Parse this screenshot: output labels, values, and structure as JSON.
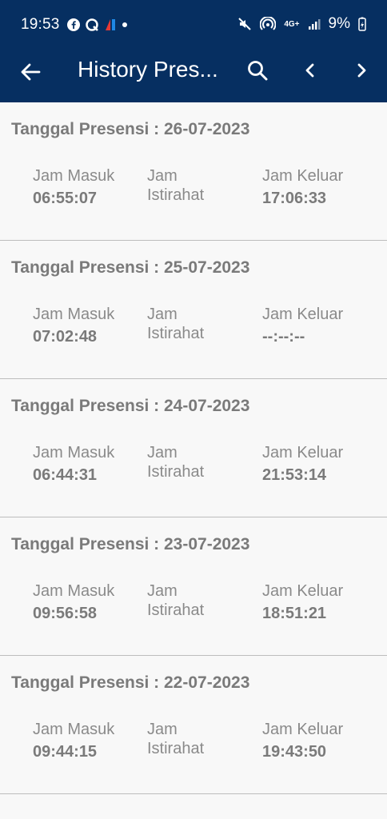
{
  "status_bar": {
    "time": "19:53",
    "battery": "9%",
    "network": "4G+"
  },
  "app_bar": {
    "title": "History Pres..."
  },
  "labels": {
    "date_prefix": "Tanggal Presensi : ",
    "jam_masuk": "Jam Masuk",
    "jam_istirahat": "Jam Istirahat",
    "jam_keluar": "Jam Keluar"
  },
  "records": [
    {
      "date": "26-07-2023",
      "masuk": "06:55:07",
      "istirahat": "",
      "keluar": "17:06:33"
    },
    {
      "date": "25-07-2023",
      "masuk": "07:02:48",
      "istirahat": "",
      "keluar": "--:--:--"
    },
    {
      "date": "24-07-2023",
      "masuk": "06:44:31",
      "istirahat": "",
      "keluar": "21:53:14"
    },
    {
      "date": "23-07-2023",
      "masuk": "09:56:58",
      "istirahat": "",
      "keluar": "18:51:21"
    },
    {
      "date": "22-07-2023",
      "masuk": "09:44:15",
      "istirahat": "",
      "keluar": "19:43:50"
    }
  ]
}
